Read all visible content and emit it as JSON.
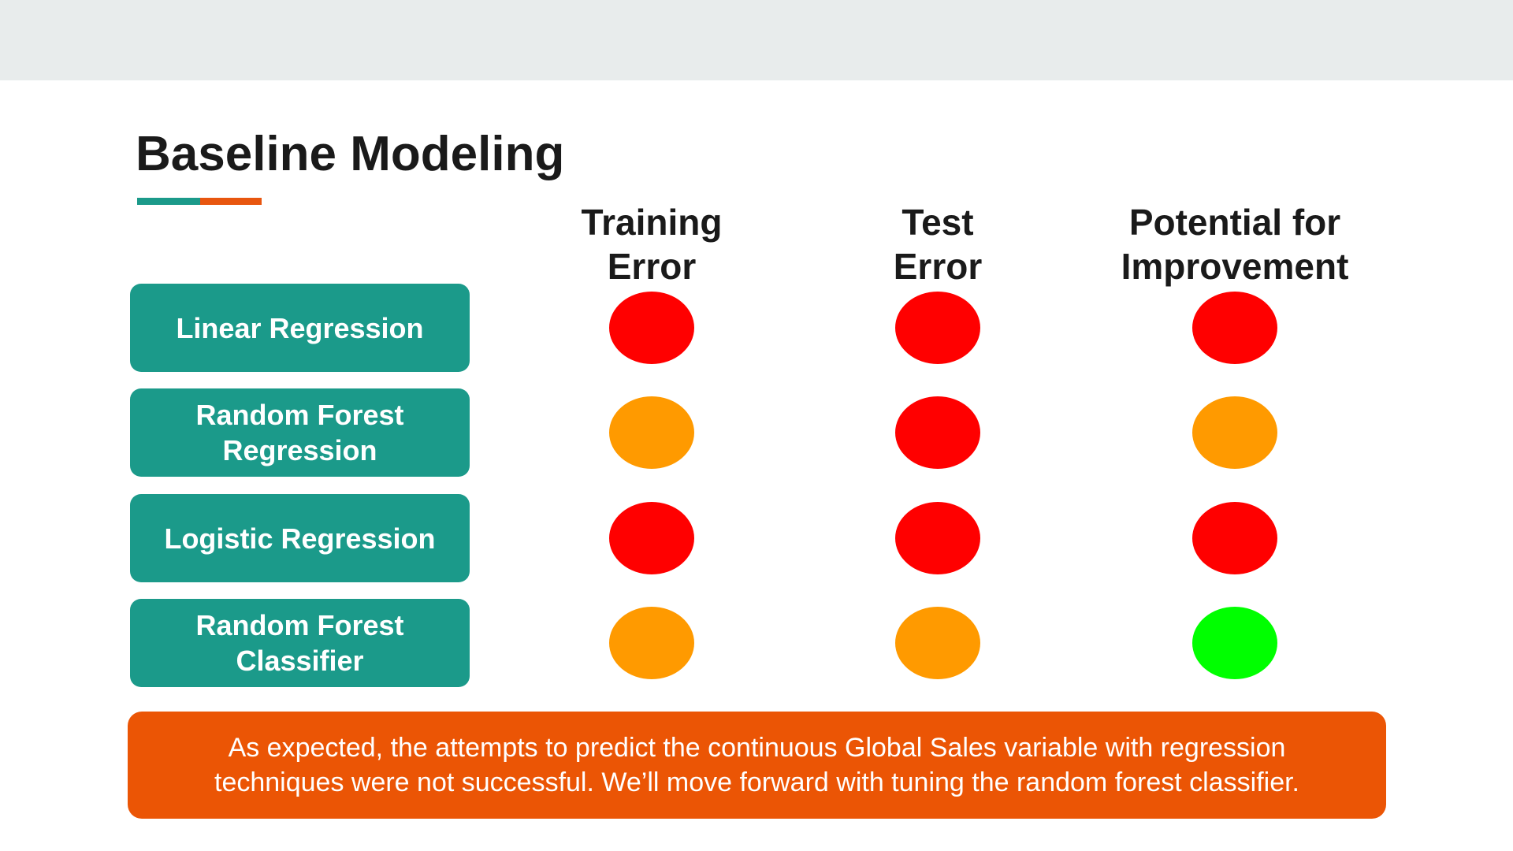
{
  "title": "Baseline Modeling",
  "accent_colors": {
    "teal": "#1b9a8a",
    "orange": "#e8560f",
    "header_band": "#e8ecec"
  },
  "columns": [
    {
      "line1": "Training",
      "line2": "Error"
    },
    {
      "line1": "Test",
      "line2": "Error"
    },
    {
      "line1": "Potential for",
      "line2": "Improvement"
    }
  ],
  "status_colors": {
    "red": "#ff0000",
    "orange": "#ff9a00",
    "green": "#00ff00"
  },
  "rows": [
    {
      "line1": "Linear Regression",
      "line2": "",
      "ratings": [
        "red",
        "red",
        "red"
      ]
    },
    {
      "line1": "Random Forest",
      "line2": "Regression",
      "ratings": [
        "orange",
        "red",
        "orange"
      ]
    },
    {
      "line1": "Logistic Regression",
      "line2": "",
      "ratings": [
        "red",
        "red",
        "red"
      ]
    },
    {
      "line1": "Random Forest",
      "line2": "Classifier",
      "ratings": [
        "orange",
        "orange",
        "green"
      ]
    }
  ],
  "conclusion": {
    "line1": "As expected, the attempts to predict the continuous Global Sales variable with regression",
    "line2": "techniques were not successful. We’ll move forward with tuning the random forest classifier."
  }
}
